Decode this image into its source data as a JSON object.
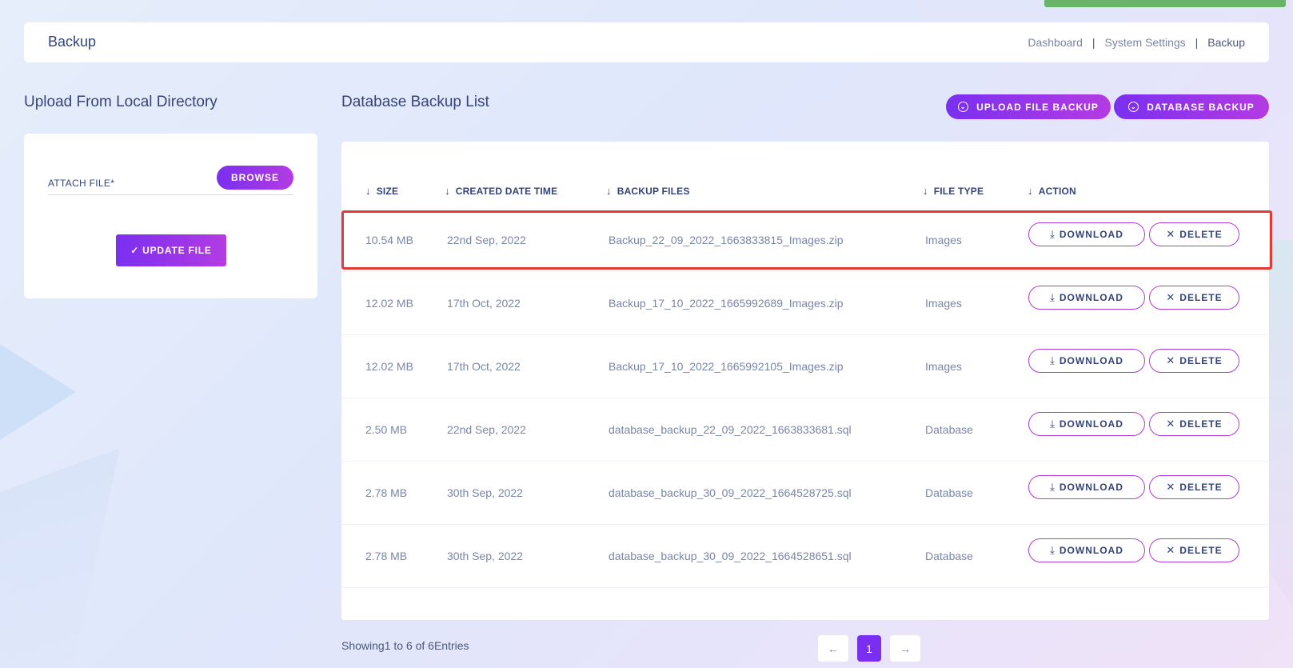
{
  "header": {
    "title": "Backup",
    "breadcrumb": [
      "Dashboard",
      "System Settings",
      "Backup"
    ]
  },
  "upload": {
    "title": "Upload From Local Directory",
    "attach_label": "ATTACH FILE*",
    "browse_label": "BROWSE",
    "update_label": "UPDATE FILE"
  },
  "list": {
    "title": "Database Backup List",
    "upload_file_backup_label": "UPLOAD FILE BACKUP",
    "database_backup_label": "DATABASE BACKUP",
    "columns": [
      "SIZE",
      "CREATED DATE TIME",
      "BACKUP FILES",
      "FILE TYPE",
      "ACTION"
    ],
    "download_label": "DOWNLOAD",
    "delete_label": "DELETE",
    "rows": [
      {
        "size": "10.54 MB",
        "date": "22nd Sep, 2022",
        "file": "Backup_22_09_2022_1663833815_Images.zip",
        "type": "Images"
      },
      {
        "size": "12.02 MB",
        "date": "17th Oct, 2022",
        "file": "Backup_17_10_2022_1665992689_Images.zip",
        "type": "Images"
      },
      {
        "size": "12.02 MB",
        "date": "17th Oct, 2022",
        "file": "Backup_17_10_2022_1665992105_Images.zip",
        "type": "Images"
      },
      {
        "size": "2.50 MB",
        "date": "22nd Sep, 2022",
        "file": "database_backup_22_09_2022_1663833681.sql",
        "type": "Database"
      },
      {
        "size": "2.78 MB",
        "date": "30th Sep, 2022",
        "file": "database_backup_30_09_2022_1664528725.sql",
        "type": "Database"
      },
      {
        "size": "2.78 MB",
        "date": "30th Sep, 2022",
        "file": "database_backup_30_09_2022_1664528651.sql",
        "type": "Database"
      }
    ]
  },
  "footer": {
    "showing": "Showing1 to 6 of 6Entries",
    "page": "1",
    "prev_icon": "arrow-left-icon",
    "next_icon": "arrow-right-icon"
  },
  "colors": {
    "accent": "#7a2ff0",
    "accent2": "#b43be2",
    "highlight": "#e53935",
    "notification": "#6ab46a"
  }
}
